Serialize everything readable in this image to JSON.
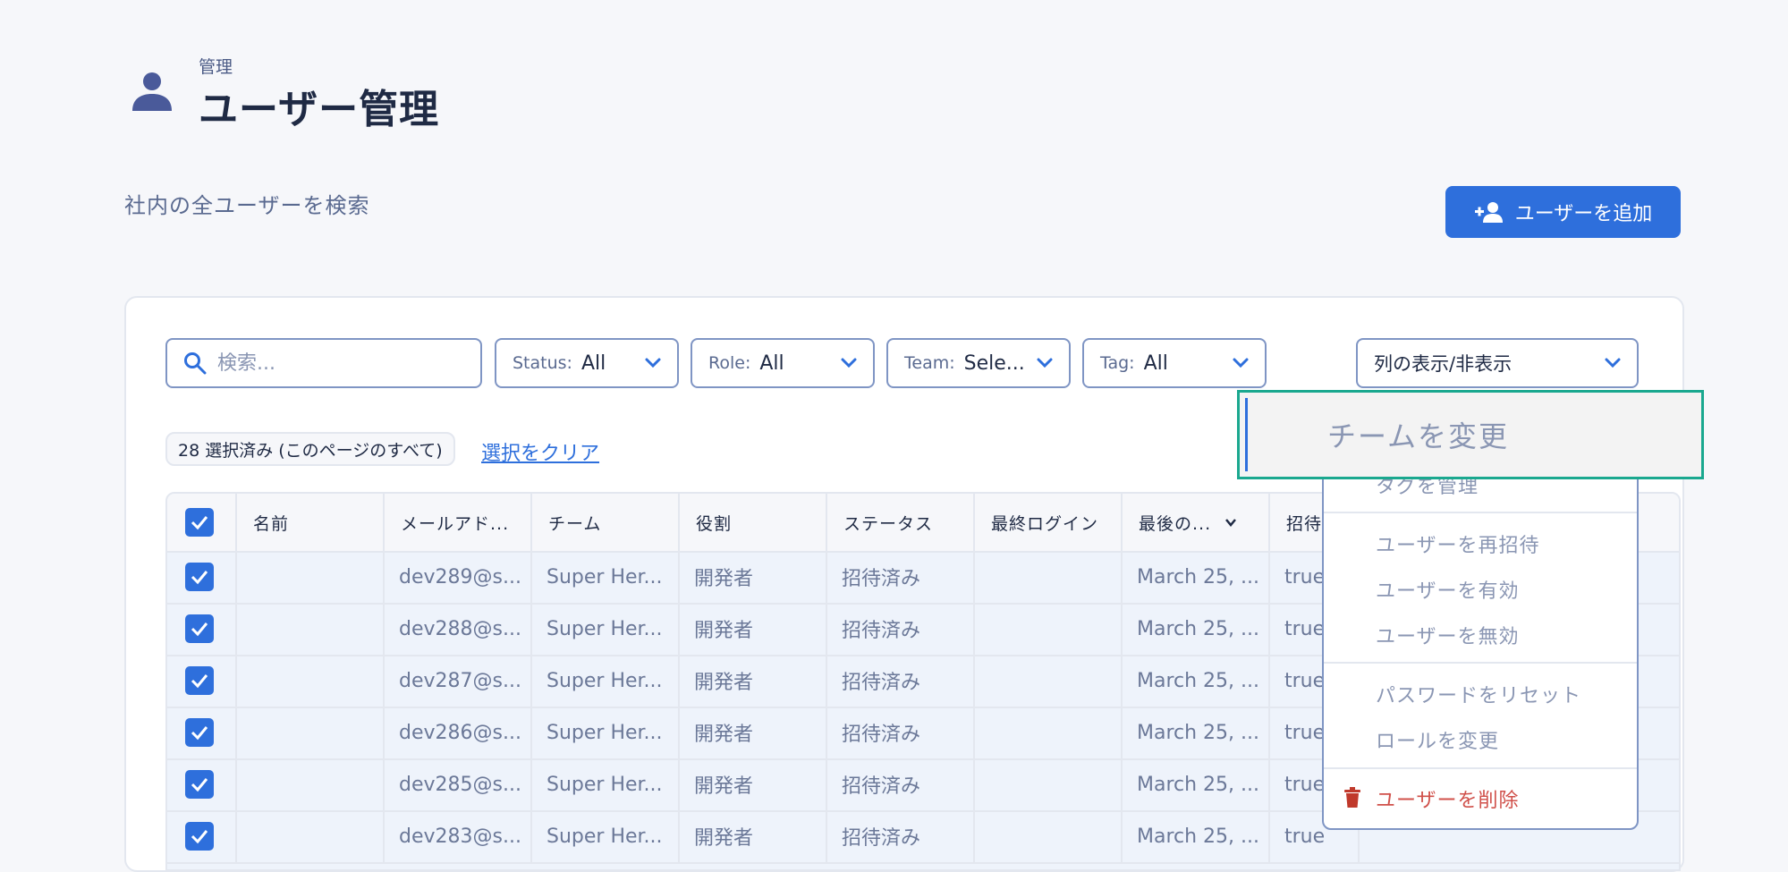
{
  "header": {
    "eyebrow": "管理",
    "title": "ユーザー管理",
    "subtitle": "社内の全ユーザーを検索",
    "icon": "person-icon"
  },
  "actions": {
    "add_user_label": "ユーザーを追加",
    "add_user_icon": "person-add-icon"
  },
  "toolbar": {
    "search_placeholder": "検索...",
    "filters": [
      {
        "label": "Status:",
        "value": "All"
      },
      {
        "label": "Role:",
        "value": "All"
      },
      {
        "label": "Team:",
        "value": "Sele..."
      },
      {
        "label": "Tag:",
        "value": "All"
      }
    ],
    "columns_toggle": "列の表示/非表示"
  },
  "selection": {
    "summary": "28 選択済み (このページのすべて)",
    "clear_label": "選択をクリア"
  },
  "table": {
    "columns": [
      "名前",
      "メールアド...",
      "チーム",
      "役割",
      "ステータス",
      "最終ログイン",
      "最後の...",
      "招待"
    ],
    "rows": [
      {
        "name": "",
        "email": "dev289@s...",
        "team": "Super Her...",
        "role": "開発者",
        "status": "招待済み",
        "last_login": "",
        "last": "March 25, ...",
        "invite": "true"
      },
      {
        "name": "",
        "email": "dev288@s...",
        "team": "Super Her...",
        "role": "開発者",
        "status": "招待済み",
        "last_login": "",
        "last": "March 25, ...",
        "invite": "true"
      },
      {
        "name": "",
        "email": "dev287@s...",
        "team": "Super Her...",
        "role": "開発者",
        "status": "招待済み",
        "last_login": "",
        "last": "March 25, ...",
        "invite": "true"
      },
      {
        "name": "",
        "email": "dev286@s...",
        "team": "Super Her...",
        "role": "開発者",
        "status": "招待済み",
        "last_login": "",
        "last": "March 25, ...",
        "invite": "true"
      },
      {
        "name": "",
        "email": "dev285@s...",
        "team": "Super Her...",
        "role": "開発者",
        "status": "招待済み",
        "last_login": "",
        "last": "March 25, ...",
        "invite": "true"
      },
      {
        "name": "",
        "email": "dev283@s...",
        "team": "Super Her...",
        "role": "開発者",
        "status": "招待済み",
        "last_login": "",
        "last": "March 25, ...",
        "invite": "true"
      }
    ]
  },
  "bulk_menu": {
    "hovered_item": "チームを変更",
    "partial_item": "タグを管理",
    "items": [
      "ユーザーを再招待",
      "ユーザーを有効",
      "ユーザーを無効",
      "パスワードをリセット",
      "ロールを変更"
    ],
    "delete_label": "ユーザーを削除",
    "colors": {
      "accent": "#2e6fdc",
      "highlight_border": "#1aa88f",
      "danger": "#d0504a"
    }
  }
}
